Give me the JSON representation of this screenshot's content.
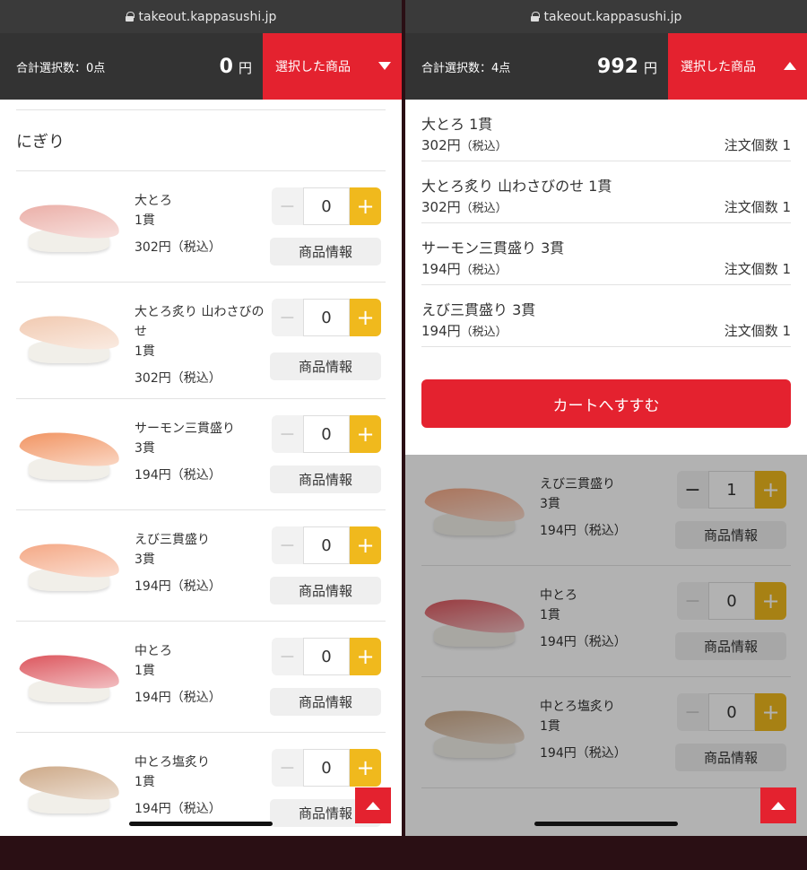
{
  "url": "takeout.kappasushi.jp",
  "left": {
    "count_label": "合計選択数：0点",
    "total_amount": "0",
    "yen": "円",
    "selected_label": "選択した商品",
    "category": "にぎり",
    "items": [
      {
        "name": "大とろ",
        "pieces": "1貫",
        "price": "302円（税込）",
        "qty": "0",
        "fish_color": "#e9a8a0"
      },
      {
        "name": "大とろ炙り 山わさびのせ",
        "pieces": "1貫",
        "price": "302円（税込）",
        "qty": "0",
        "fish_color": "#f0c5aa"
      },
      {
        "name": "サーモン三貫盛り",
        "pieces": "3貫",
        "price": "194円（税込）",
        "qty": "0",
        "fish_color": "#f08b55"
      },
      {
        "name": "えび三貫盛り",
        "pieces": "3貫",
        "price": "194円（税込）",
        "qty": "0",
        "fish_color": "#f3a07a"
      },
      {
        "name": "中とろ",
        "pieces": "1貫",
        "price": "194円（税込）",
        "qty": "0",
        "fish_color": "#d9474f"
      },
      {
        "name": "中とろ塩炙り",
        "pieces": "1貫",
        "price": "194円（税込）",
        "qty": "0",
        "fish_color": "#c9a27e"
      }
    ]
  },
  "right": {
    "count_label": "合計選択数：4点",
    "total_amount": "992",
    "yen": "円",
    "selected_label": "選択した商品",
    "selected_items": [
      {
        "name": "大とろ 1貫",
        "price": "302円",
        "tax": "（税込）",
        "qty_label": "注文個数 1"
      },
      {
        "name": "大とろ炙り 山わさびのせ 1貫",
        "price": "302円",
        "tax": "（税込）",
        "qty_label": "注文個数 1"
      },
      {
        "name": "サーモン三貫盛り 3貫",
        "price": "194円",
        "tax": "（税込）",
        "qty_label": "注文個数 1"
      },
      {
        "name": "えび三貫盛り 3貫",
        "price": "194円",
        "tax": "（税込）",
        "qty_label": "注文個数 1"
      }
    ],
    "cart_button": "カートへすすむ",
    "behind_items": [
      {
        "name": "",
        "pieces": "",
        "price": "194円（税込）",
        "qty": "",
        "fish_color": "#f08b55"
      },
      {
        "name": "えび三貫盛り",
        "pieces": "3貫",
        "price": "194円（税込）",
        "qty": "1",
        "fish_color": "#f3a07a"
      },
      {
        "name": "中とろ",
        "pieces": "1貫",
        "price": "194円（税込）",
        "qty": "0",
        "fish_color": "#d9474f"
      },
      {
        "name": "中とろ塩炙り",
        "pieces": "1貫",
        "price": "194円（税込）",
        "qty": "0",
        "fish_color": "#c9a27e"
      }
    ]
  },
  "product_info_label": "商品情報",
  "minus_symbol": "−",
  "plus_symbol": "+",
  "colors": {
    "brand_red": "#e4222f",
    "plus_yellow": "#f0b91d",
    "header_dark": "#333333"
  }
}
